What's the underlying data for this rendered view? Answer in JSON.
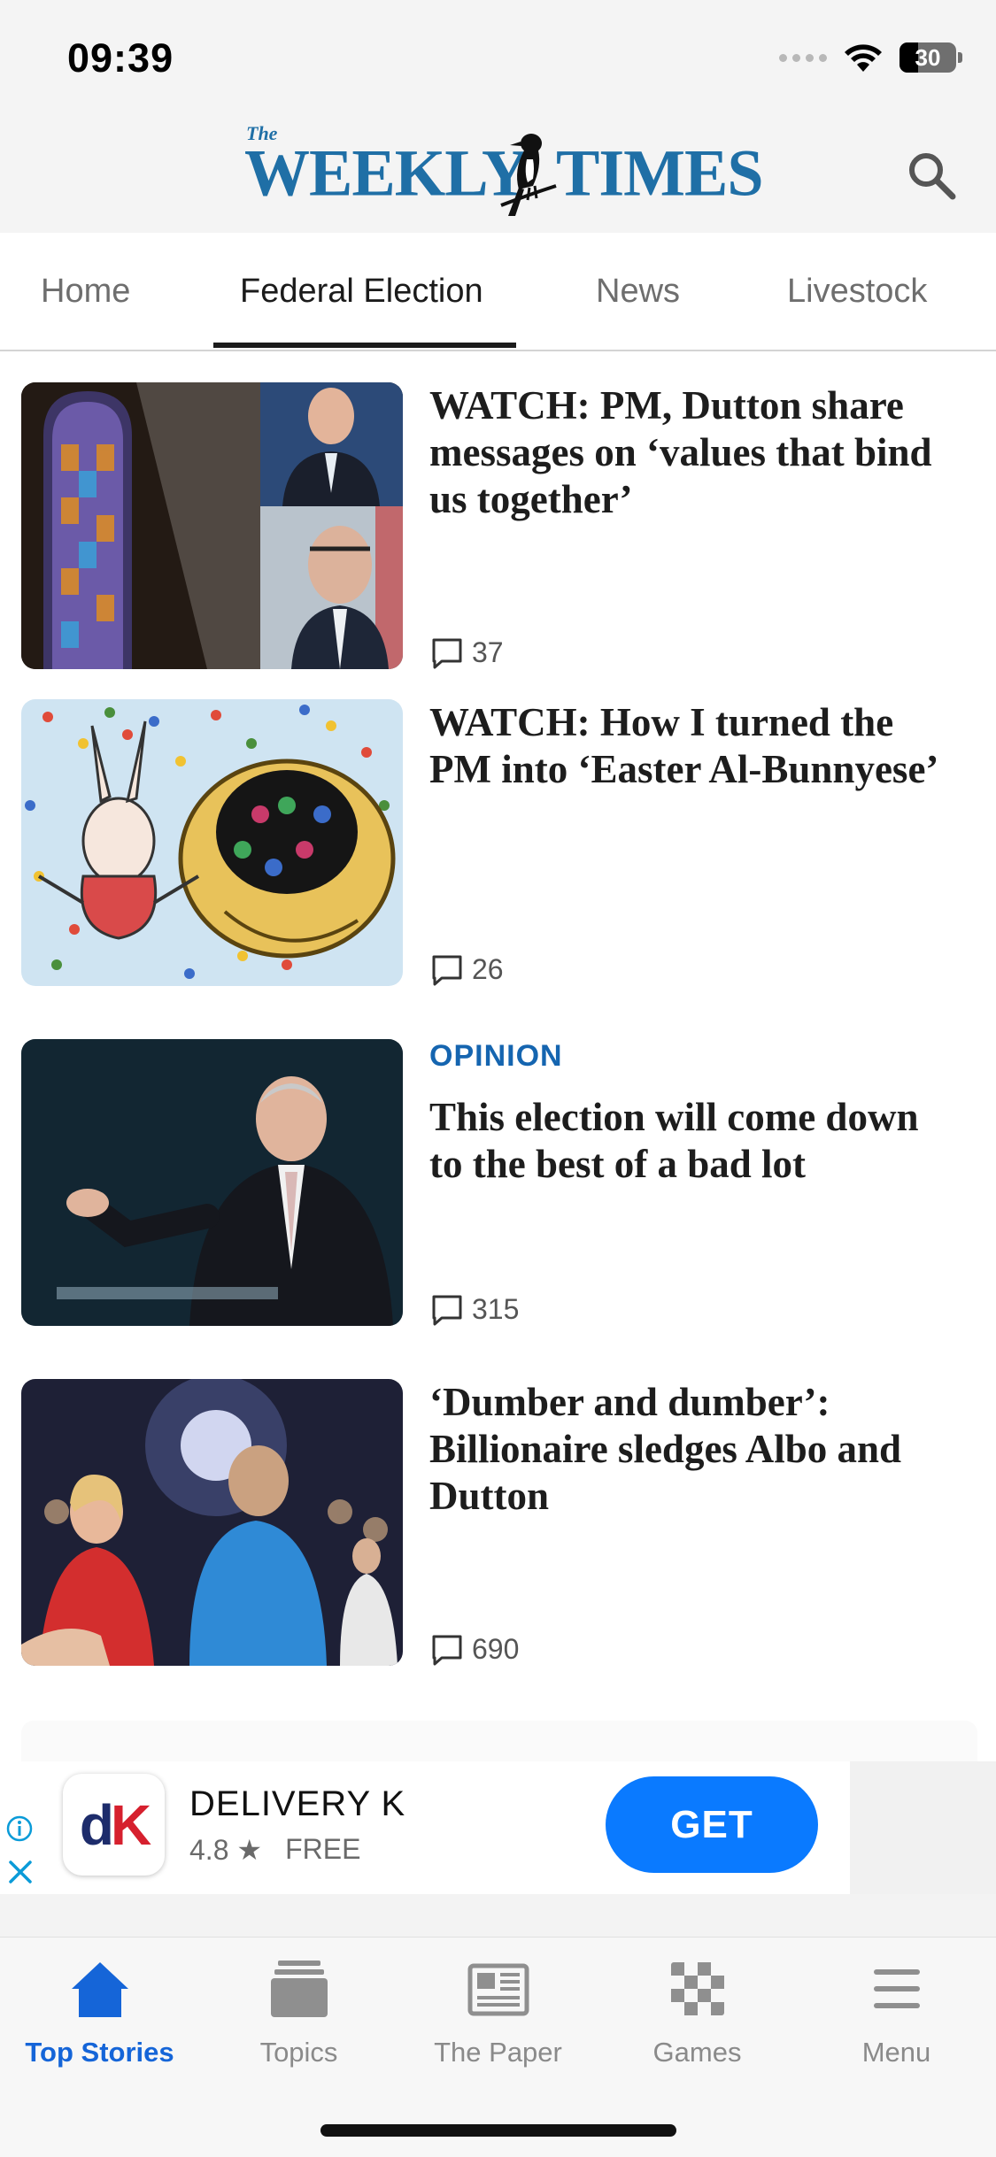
{
  "status_bar": {
    "time": "09:39",
    "battery": "30"
  },
  "header": {
    "logo_small": "The",
    "logo_word_1": "WEEKLY",
    "logo_word_2": "TIMES"
  },
  "tabs": [
    {
      "label": "Home",
      "active": false
    },
    {
      "label": "Federal Election",
      "active": true
    },
    {
      "label": "News",
      "active": false
    },
    {
      "label": "Livestock",
      "active": false
    }
  ],
  "stories": [
    {
      "kicker": "",
      "headline": "WATCH: PM, Dutton share messages on ‘values that bind us together’",
      "comments": "37"
    },
    {
      "kicker": "",
      "headline": "WATCH: How I turned the PM into ‘Easter Al-Bunnyese’",
      "comments": "26"
    },
    {
      "kicker": "OPINION",
      "headline": "This election will come down to the best of a bad lot",
      "comments": "315"
    },
    {
      "kicker": "",
      "headline": "‘Dumber and dumber’: Billionaire sledges Albo and Dutton",
      "comments": "690"
    }
  ],
  "ad": {
    "app_name": "DELIVERY K",
    "rating": "4.8 ★",
    "price": "FREE",
    "cta": "GET",
    "icon_letters": {
      "d": "d",
      "k": "K"
    }
  },
  "bottom_nav": [
    {
      "label": "Top Stories",
      "icon": "home-icon",
      "active": true
    },
    {
      "label": "Topics",
      "icon": "topics-icon",
      "active": false
    },
    {
      "label": "The Paper",
      "icon": "newspaper-icon",
      "active": false
    },
    {
      "label": "Games",
      "icon": "games-icon",
      "active": false
    },
    {
      "label": "Menu",
      "icon": "menu-icon",
      "active": false
    }
  ],
  "colors": {
    "brand_blue": "#1f6fa6",
    "kicker_blue": "#1565b0",
    "active_nav": "#1565d8",
    "cta_blue": "#0a7aff"
  }
}
